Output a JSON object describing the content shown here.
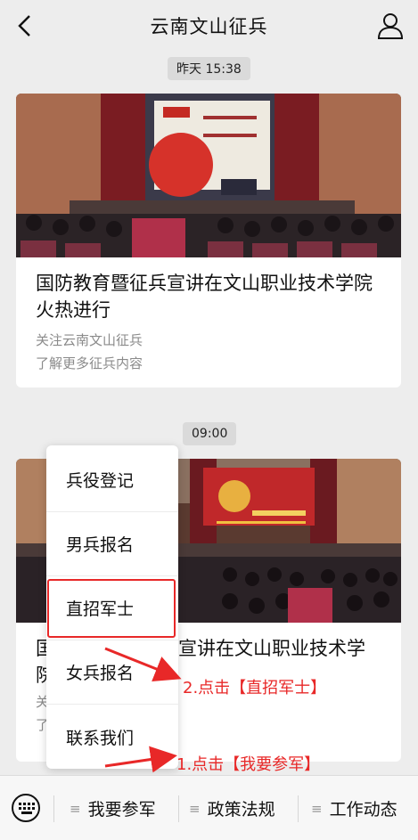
{
  "header": {
    "title": "云南文山征兵",
    "back_icon": "chevron-left-icon",
    "profile_icon": "person-icon"
  },
  "messages": [
    {
      "time": "昨天 15:38",
      "headline": "国防教育暨征兵宣讲在文山职业技术学院火热进行",
      "sub1": "关注云南文山征兵",
      "sub2": "了解更多征兵内容"
    },
    {
      "time": "09:00",
      "headline_left": "国",
      "headline_right": "宣讲在文山职业技术学",
      "headline_line2": "院",
      "sub1": "关",
      "sub2": "了"
    }
  ],
  "menu": {
    "items": [
      "兵役登记",
      "男兵报名",
      "直招军士",
      "女兵报名",
      "联系我们"
    ],
    "highlighted_index": 2
  },
  "annotations": {
    "step2": "2.点击【直招军士】",
    "step1": "1.点击【我要参军】",
    "color": "#e82828"
  },
  "bottombar": {
    "keyboard_icon": "keyboard-icon",
    "tabs": [
      "我要参军",
      "政策法规",
      "工作动态"
    ]
  }
}
